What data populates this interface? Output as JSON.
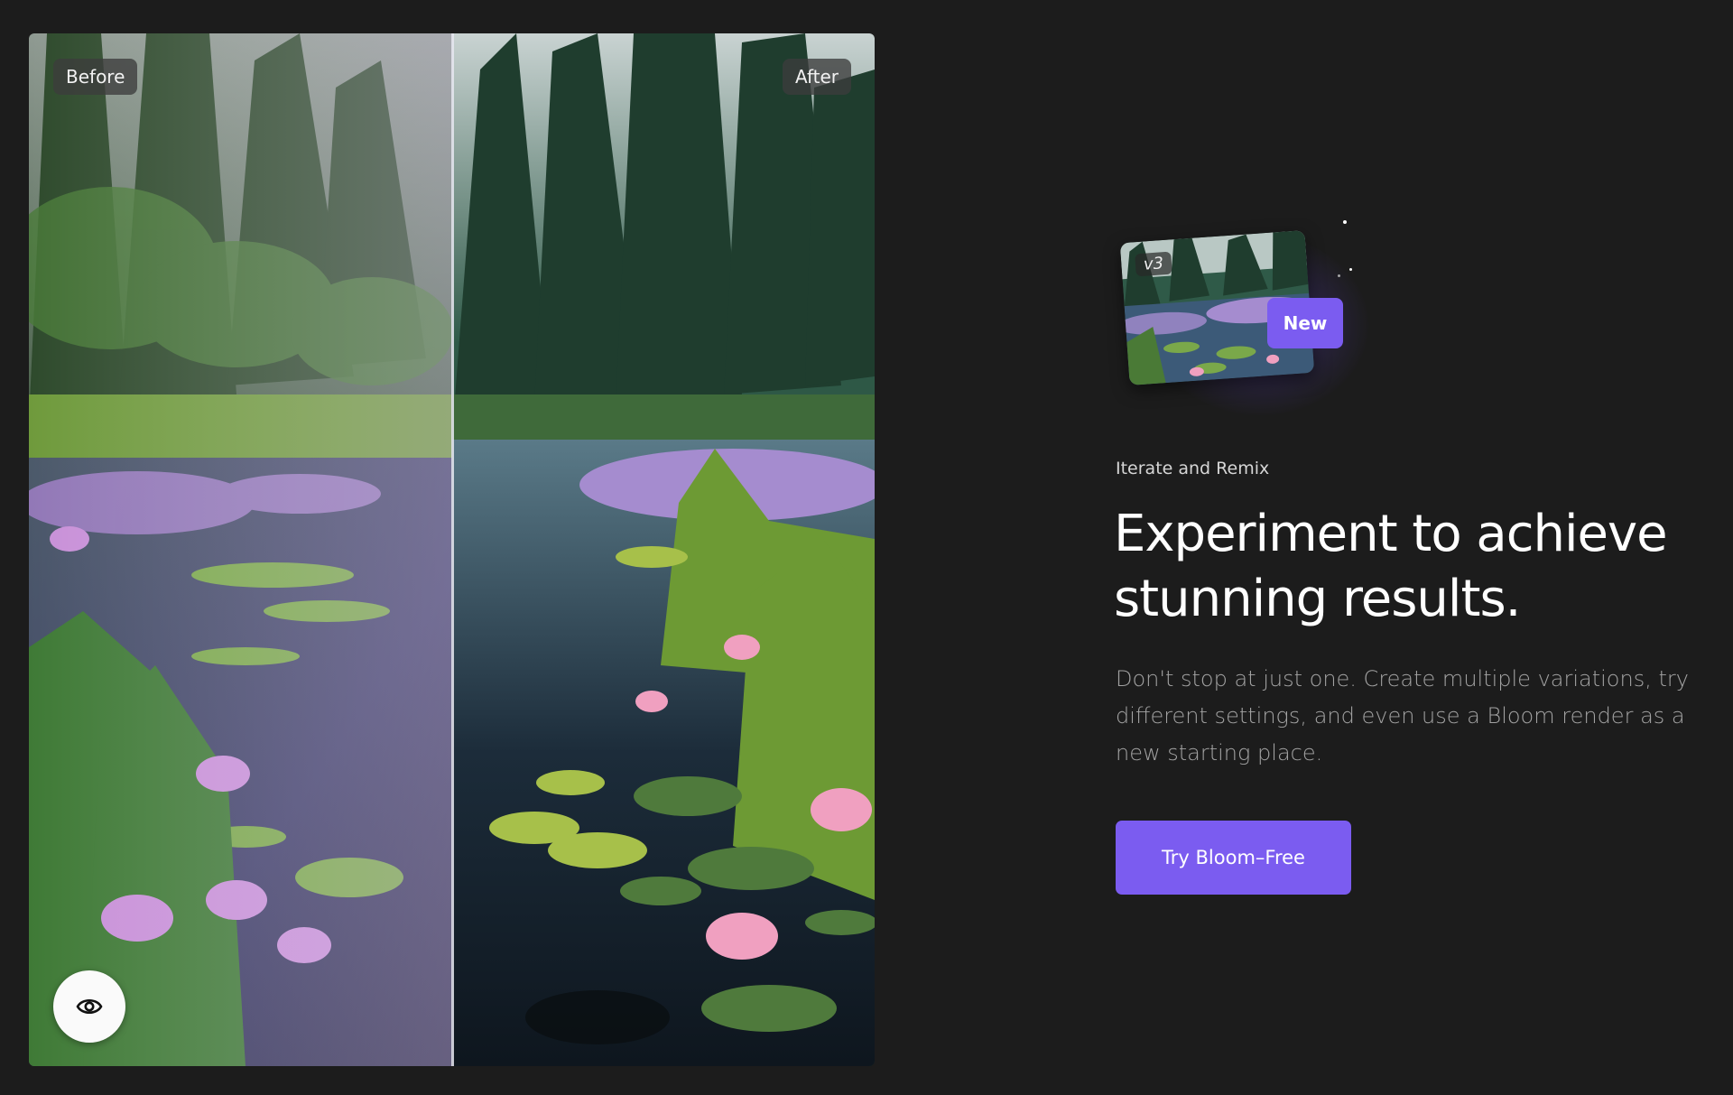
{
  "comparison": {
    "before_label": "Before",
    "after_label": "After",
    "preview_icon": "eye-icon"
  },
  "feature": {
    "version_label": "v3",
    "new_badge": "New",
    "eyebrow": "Iterate and Remix",
    "headline": "Experiment to achieve stunning results.",
    "body": "Don't stop at just one. Create multiple variations, try different settings, and even use a Bloom render as a new starting place.",
    "cta_label": "Try Bloom–Free"
  },
  "colors": {
    "background": "#1c1c1c",
    "accent": "#7b5cf0",
    "body_text": "#a3a3a3"
  }
}
